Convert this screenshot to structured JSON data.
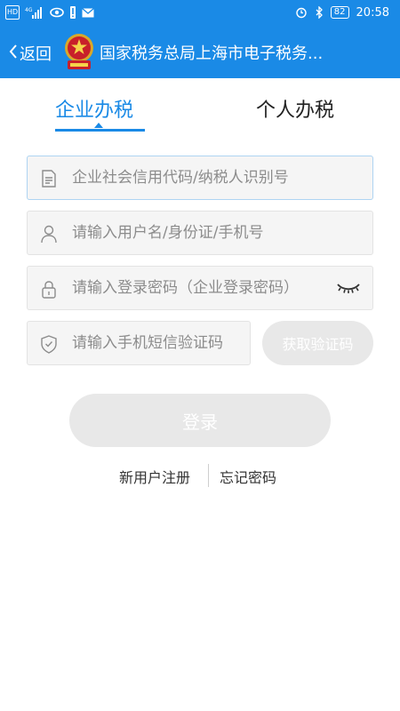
{
  "status_bar": {
    "network_badge": "HD",
    "signal_label": "4G",
    "battery": "82",
    "time": "20:58"
  },
  "header": {
    "back_label": "返回",
    "title": "国家税务总局上海市电子税务..."
  },
  "tabs": [
    {
      "label": "企业办税",
      "active": true
    },
    {
      "label": "个人办税",
      "active": false
    }
  ],
  "form": {
    "credit_code_placeholder": "企业社会信用代码/纳税人识别号",
    "username_placeholder": "请输入用户名/身份证/手机号",
    "password_placeholder": "请输入登录密码（企业登录密码）",
    "sms_placeholder": "请输入手机短信验证码",
    "get_code_label": "获取验证码",
    "login_label": "登录"
  },
  "links": {
    "register": "新用户注册",
    "forgot": "忘记密码"
  },
  "icons": {
    "back": "chevron-left-icon",
    "emblem": "tax-emblem-icon",
    "credit_code": "document-icon",
    "username": "user-icon",
    "password": "lock-icon",
    "sms": "shield-check-icon",
    "eye": "eye-closed-icon"
  },
  "colors": {
    "accent": "#1a8ae6",
    "disabled_button": "#e8e8e8",
    "field_background": "#f5f5f5",
    "placeholder": "#8c8c8c"
  }
}
